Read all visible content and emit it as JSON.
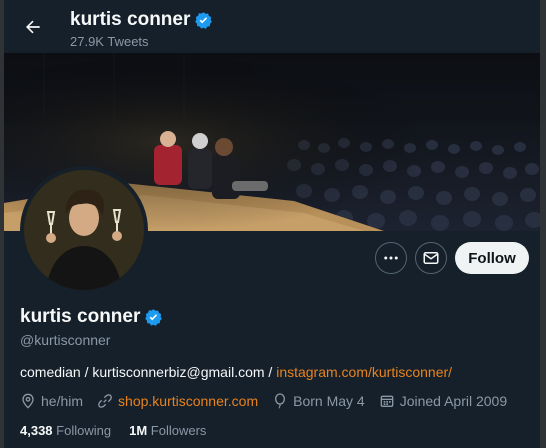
{
  "header": {
    "name": "kurtis conner",
    "tweet_count": "27.9K Tweets"
  },
  "banner": {
    "description": "comedy stage photo"
  },
  "actions": {
    "follow_label": "Follow"
  },
  "profile": {
    "name": "kurtis conner",
    "handle": "@kurtisconner",
    "bio_text": "comedian / kurtisconnerbiz@gmail.com / ",
    "bio_link": "instagram.com/kurtisconner/",
    "pronouns": "he/him",
    "website": "shop.kurtisconner.com",
    "birthday": "Born May 4",
    "joined": "Joined April 2009"
  },
  "stats": {
    "following_count": "4,338",
    "following_label": "Following",
    "followers_count": "1M",
    "followers_label": "Followers"
  },
  "colors": {
    "background": "#15202b",
    "accent_link": "#e8831f",
    "verified": "#1d9bf0",
    "muted": "#8b98a5"
  }
}
